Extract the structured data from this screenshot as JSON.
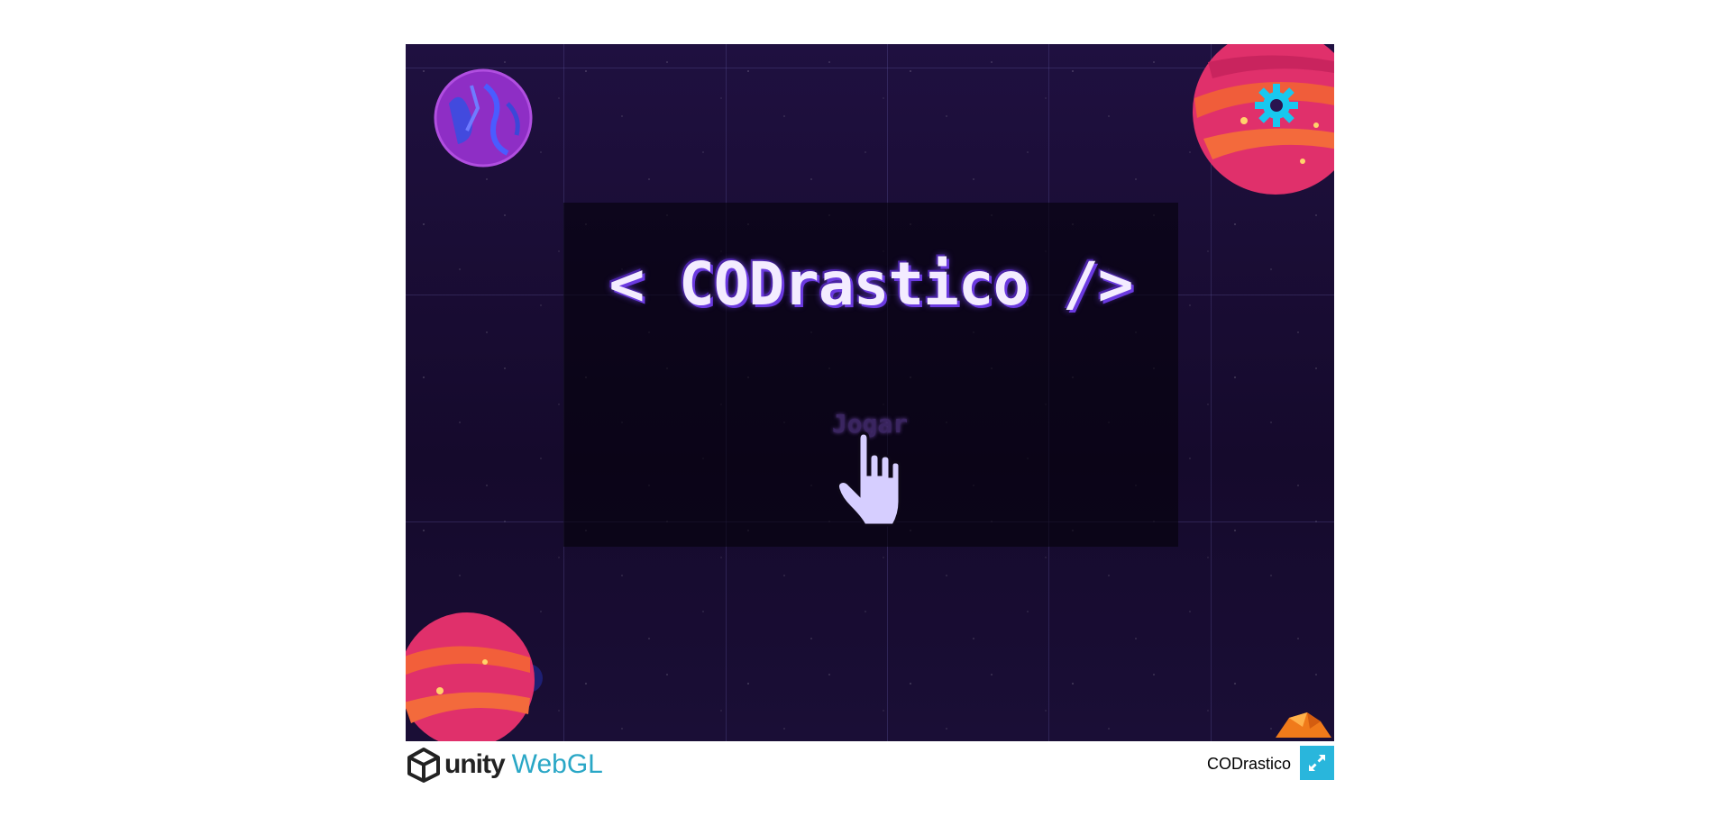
{
  "game": {
    "title": "< CODrastico />",
    "play_label": "Jogar"
  },
  "footer": {
    "logo_unity": "unity",
    "logo_webgl": "WebGL",
    "build_title": "CODrastico"
  },
  "icons": {
    "settings": "gear-icon",
    "fullscreen": "fullscreen-icon",
    "cursor": "hand-pointer-icon"
  },
  "colors": {
    "gear": "#18c8ef",
    "fullscreen_bg": "#29b6dc",
    "webgl_text": "#2aa7c6",
    "title_glow": "#6b3ae0"
  }
}
